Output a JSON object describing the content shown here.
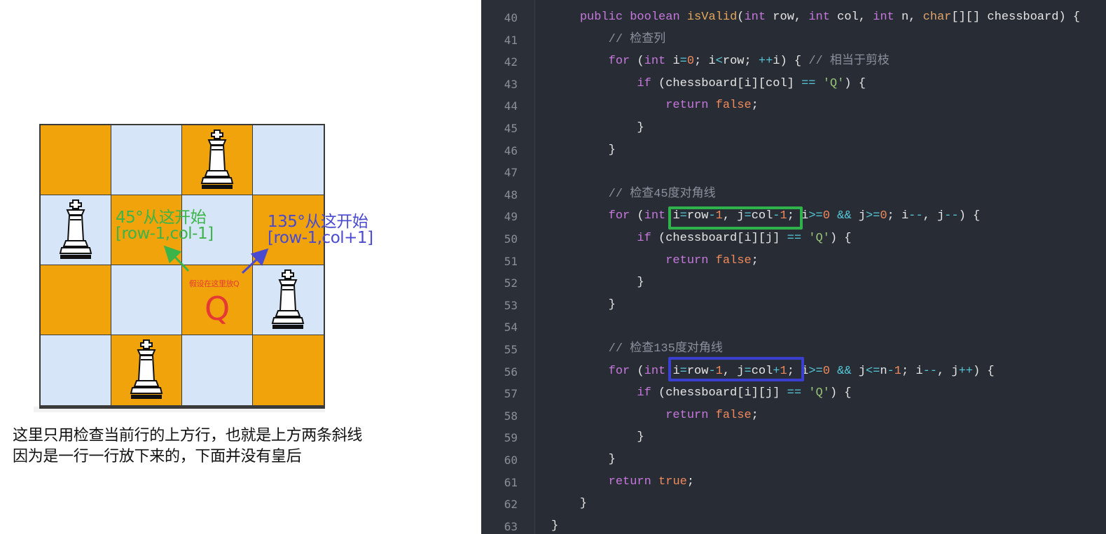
{
  "diagram": {
    "board": {
      "rows": 4,
      "cols": 4,
      "colors": {
        "light": "#d6e6f8",
        "dark": "#f0a30a",
        "border": "#3a3a3a"
      },
      "pattern": [
        [
          "orange",
          "blue",
          "orange",
          "blue"
        ],
        [
          "blue",
          "orange",
          "blue",
          "orange"
        ],
        [
          "orange",
          "blue",
          "orange",
          "blue"
        ],
        [
          "blue",
          "orange",
          "blue",
          "orange"
        ]
      ],
      "queens": [
        {
          "row": 0,
          "col": 2
        },
        {
          "row": 1,
          "col": 0
        },
        {
          "row": 2,
          "col": 3
        },
        {
          "row": 3,
          "col": 1
        }
      ],
      "piece_icon": "chess-queen-icon"
    },
    "annotation_45": {
      "title": "45°从这开始",
      "coord": "[row-1,col-1]",
      "color": "#3cb44a"
    },
    "annotation_135": {
      "title": "135°从这开始",
      "coord": "[row-1,col+1]",
      "color": "#4a4ad0"
    },
    "assume_label": "假设在这里放Q",
    "q_mark": "Q",
    "q_color": "#e53935",
    "caption_line1": "这里只用检查当前行的上方行，也就是上方两条斜线",
    "caption_line2": "因为是一行一行放下来的，下面并没有皇后"
  },
  "editor": {
    "colors": {
      "background": "#282c34",
      "gutter": "#2b2f37",
      "highlight_45": "#2fb24c",
      "highlight_135": "#3b3fd0"
    },
    "line_numbers": [
      "40",
      "41",
      "42",
      "43",
      "44",
      "45",
      "46",
      "47",
      "48",
      "49",
      "50",
      "51",
      "52",
      "53",
      "54",
      "55",
      "56",
      "57",
      "58",
      "59",
      "60",
      "61",
      "62",
      "63"
    ],
    "lines": [
      [
        {
          "t": "    "
        },
        {
          "t": "public ",
          "c": "ty"
        },
        {
          "t": "boolean ",
          "c": "ty"
        },
        {
          "t": "isValid",
          "c": "fn"
        },
        {
          "t": "("
        },
        {
          "t": "int ",
          "c": "ty"
        },
        {
          "t": "row, "
        },
        {
          "t": "int ",
          "c": "ty"
        },
        {
          "t": "col, "
        },
        {
          "t": "int ",
          "c": "ty"
        },
        {
          "t": "n, "
        },
        {
          "t": "char",
          "c": "kw"
        },
        {
          "t": "[][] chessboard) {"
        }
      ],
      [
        {
          "t": "        "
        },
        {
          "t": "// 检查列",
          "c": "cm"
        }
      ],
      [
        {
          "t": "        "
        },
        {
          "t": "for ",
          "c": "ty"
        },
        {
          "t": "("
        },
        {
          "t": "int ",
          "c": "ty"
        },
        {
          "t": "i"
        },
        {
          "t": "=",
          "c": "op"
        },
        {
          "t": "0",
          "c": "num"
        },
        {
          "t": "; i"
        },
        {
          "t": "<",
          "c": "op"
        },
        {
          "t": "row; "
        },
        {
          "t": "++",
          "c": "op"
        },
        {
          "t": "i) { "
        },
        {
          "t": "// 相当于剪枝",
          "c": "cm"
        }
      ],
      [
        {
          "t": "            "
        },
        {
          "t": "if ",
          "c": "ty"
        },
        {
          "t": "(chessboard[i][col] "
        },
        {
          "t": "==",
          "c": "op"
        },
        {
          "t": " "
        },
        {
          "t": "'Q'",
          "c": "str"
        },
        {
          "t": ") {"
        }
      ],
      [
        {
          "t": "                "
        },
        {
          "t": "return ",
          "c": "ty"
        },
        {
          "t": "false",
          "c": "num"
        },
        {
          "t": ";"
        }
      ],
      [
        {
          "t": "            }"
        }
      ],
      [
        {
          "t": "        }"
        }
      ],
      [],
      [
        {
          "t": "        "
        },
        {
          "t": "// 检查45度对角线",
          "c": "cm"
        }
      ],
      [
        {
          "t": "        "
        },
        {
          "t": "for ",
          "c": "ty"
        },
        {
          "t": "("
        },
        {
          "t": "int ",
          "c": "ty"
        },
        {
          "t": "i"
        },
        {
          "t": "=",
          "c": "op"
        },
        {
          "t": "row"
        },
        {
          "t": "-",
          "c": "op"
        },
        {
          "t": "1",
          "c": "num"
        },
        {
          "t": ", j"
        },
        {
          "t": "=",
          "c": "op"
        },
        {
          "t": "col"
        },
        {
          "t": "-",
          "c": "op"
        },
        {
          "t": "1",
          "c": "num"
        },
        {
          "t": "; i"
        },
        {
          "t": ">=",
          "c": "op"
        },
        {
          "t": "0",
          "c": "num"
        },
        {
          "t": " "
        },
        {
          "t": "&&",
          "c": "op"
        },
        {
          "t": " j"
        },
        {
          "t": ">=",
          "c": "op"
        },
        {
          "t": "0",
          "c": "num"
        },
        {
          "t": "; i"
        },
        {
          "t": "--",
          "c": "op"
        },
        {
          "t": ", j"
        },
        {
          "t": "--",
          "c": "op"
        },
        {
          "t": ") {"
        }
      ],
      [
        {
          "t": "            "
        },
        {
          "t": "if ",
          "c": "ty"
        },
        {
          "t": "(chessboard[i][j] "
        },
        {
          "t": "==",
          "c": "op"
        },
        {
          "t": " "
        },
        {
          "t": "'Q'",
          "c": "str"
        },
        {
          "t": ") {"
        }
      ],
      [
        {
          "t": "                "
        },
        {
          "t": "return ",
          "c": "ty"
        },
        {
          "t": "false",
          "c": "num"
        },
        {
          "t": ";"
        }
      ],
      [
        {
          "t": "            }"
        }
      ],
      [
        {
          "t": "        }"
        }
      ],
      [],
      [
        {
          "t": "        "
        },
        {
          "t": "// 检查135度对角线",
          "c": "cm"
        }
      ],
      [
        {
          "t": "        "
        },
        {
          "t": "for ",
          "c": "ty"
        },
        {
          "t": "("
        },
        {
          "t": "int ",
          "c": "ty"
        },
        {
          "t": "i"
        },
        {
          "t": "=",
          "c": "op"
        },
        {
          "t": "row"
        },
        {
          "t": "-",
          "c": "op"
        },
        {
          "t": "1",
          "c": "num"
        },
        {
          "t": ", j"
        },
        {
          "t": "=",
          "c": "op"
        },
        {
          "t": "col"
        },
        {
          "t": "+",
          "c": "op"
        },
        {
          "t": "1",
          "c": "num"
        },
        {
          "t": "; i"
        },
        {
          "t": ">=",
          "c": "op"
        },
        {
          "t": "0",
          "c": "num"
        },
        {
          "t": " "
        },
        {
          "t": "&&",
          "c": "op"
        },
        {
          "t": " j"
        },
        {
          "t": "<=",
          "c": "op"
        },
        {
          "t": "n"
        },
        {
          "t": "-",
          "c": "op"
        },
        {
          "t": "1",
          "c": "num"
        },
        {
          "t": "; i"
        },
        {
          "t": "--",
          "c": "op"
        },
        {
          "t": ", j"
        },
        {
          "t": "++",
          "c": "op"
        },
        {
          "t": ") {"
        }
      ],
      [
        {
          "t": "            "
        },
        {
          "t": "if ",
          "c": "ty"
        },
        {
          "t": "(chessboard[i][j] "
        },
        {
          "t": "==",
          "c": "op"
        },
        {
          "t": " "
        },
        {
          "t": "'Q'",
          "c": "str"
        },
        {
          "t": ") {"
        }
      ],
      [
        {
          "t": "                "
        },
        {
          "t": "return ",
          "c": "ty"
        },
        {
          "t": "false",
          "c": "num"
        },
        {
          "t": ";"
        }
      ],
      [
        {
          "t": "            }"
        }
      ],
      [
        {
          "t": "        }"
        }
      ],
      [
        {
          "t": "        "
        },
        {
          "t": "return ",
          "c": "ty"
        },
        {
          "t": "true",
          "c": "num"
        },
        {
          "t": ";"
        }
      ],
      [
        {
          "t": "    }"
        }
      ],
      [
        {
          "t": "}"
        }
      ]
    ]
  }
}
